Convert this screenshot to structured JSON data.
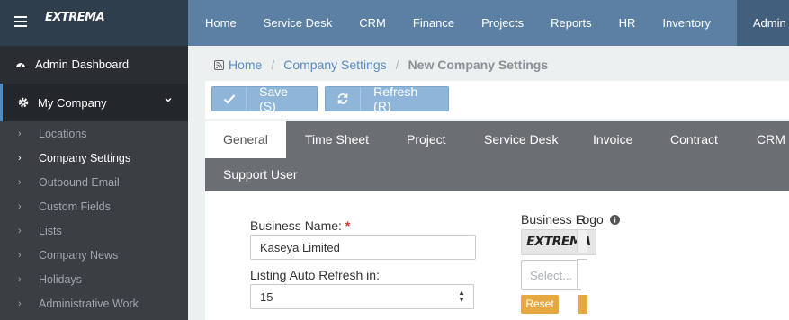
{
  "brand": {
    "logo_text": "EXTREMA"
  },
  "nav": [
    "Home",
    "Service Desk",
    "CRM",
    "Finance",
    "Projects",
    "Reports",
    "HR",
    "Inventory",
    "Admin"
  ],
  "nav_active": "Admin",
  "sidebar": {
    "dashboard": "Admin Dashboard",
    "section": "My Company",
    "items": [
      "Locations",
      "Company Settings",
      "Outbound Email",
      "Custom Fields",
      "Lists",
      "Company News",
      "Holidays",
      "Administrative Work"
    ],
    "active_item": "Company Settings"
  },
  "breadcrumb": {
    "home": "Home",
    "parent": "Company Settings",
    "current": "New Company Settings"
  },
  "toolbar": {
    "save_label": "Save (S)",
    "refresh_label": "Refresh (R)"
  },
  "tabs": [
    "General",
    "Time Sheet",
    "Project",
    "Service Desk",
    "Invoice",
    "Contract",
    "CRM",
    "Support User"
  ],
  "active_tab": "General",
  "form": {
    "business_name_label": "Business Name:",
    "business_name_required": "*",
    "business_name_value": "Kaseya Limited",
    "listing_refresh_label": "Listing Auto Refresh in:",
    "listing_refresh_value": "15",
    "business_logo_label": "Business Logo",
    "logo_preview_text": "EXTREMA",
    "select_placeholder": "Select...",
    "reset_label": "Reset",
    "right_label_partial": "R"
  },
  "colors": {
    "topbar": "#5b80a4",
    "sidebar": "#3b3f44",
    "accent": "#4d8bc4",
    "button": "#8fb6d9",
    "reset": "#e7a841",
    "required": "#d9342b"
  }
}
